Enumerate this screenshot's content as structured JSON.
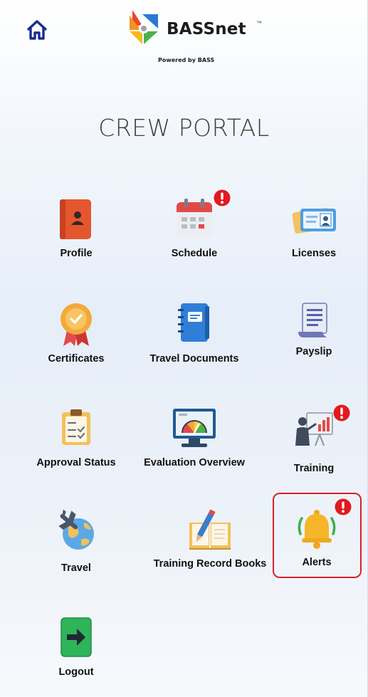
{
  "header": {
    "brand_name": "BASSnet",
    "trademark": "™",
    "powered_by": "Powered by BASS"
  },
  "portal": {
    "title": "CREW PORTAL"
  },
  "tiles": [
    {
      "label": "Profile",
      "icon": "profile-book-icon",
      "alert": false
    },
    {
      "label": "Schedule",
      "icon": "calendar-icon",
      "alert": true
    },
    {
      "label": "Licenses",
      "icon": "id-card-icon",
      "alert": false
    },
    {
      "label": "Certificates",
      "icon": "award-medal-icon",
      "alert": false
    },
    {
      "label": "Travel Documents",
      "icon": "notebook-icon",
      "alert": false
    },
    {
      "label": "Payslip",
      "icon": "scroll-document-icon",
      "alert": false
    },
    {
      "label": "Approval Status",
      "icon": "clipboard-check-icon",
      "alert": false
    },
    {
      "label": "Evaluation Overview",
      "icon": "monitor-gauge-icon",
      "alert": false
    },
    {
      "label": "Training",
      "icon": "presentation-board-icon",
      "alert": true
    },
    {
      "label": "Travel",
      "icon": "globe-airplane-icon",
      "alert": false
    },
    {
      "label": "Training Record Books",
      "icon": "open-book-pen-icon",
      "alert": false
    },
    {
      "label": "Alerts",
      "icon": "bell-icon",
      "alert": true,
      "selected": true
    },
    {
      "label": "Logout",
      "icon": "logout-arrow-icon",
      "alert": false
    }
  ],
  "colors": {
    "badge": "#e3191f",
    "selection_border": "#d8212a",
    "text": "#111111"
  }
}
